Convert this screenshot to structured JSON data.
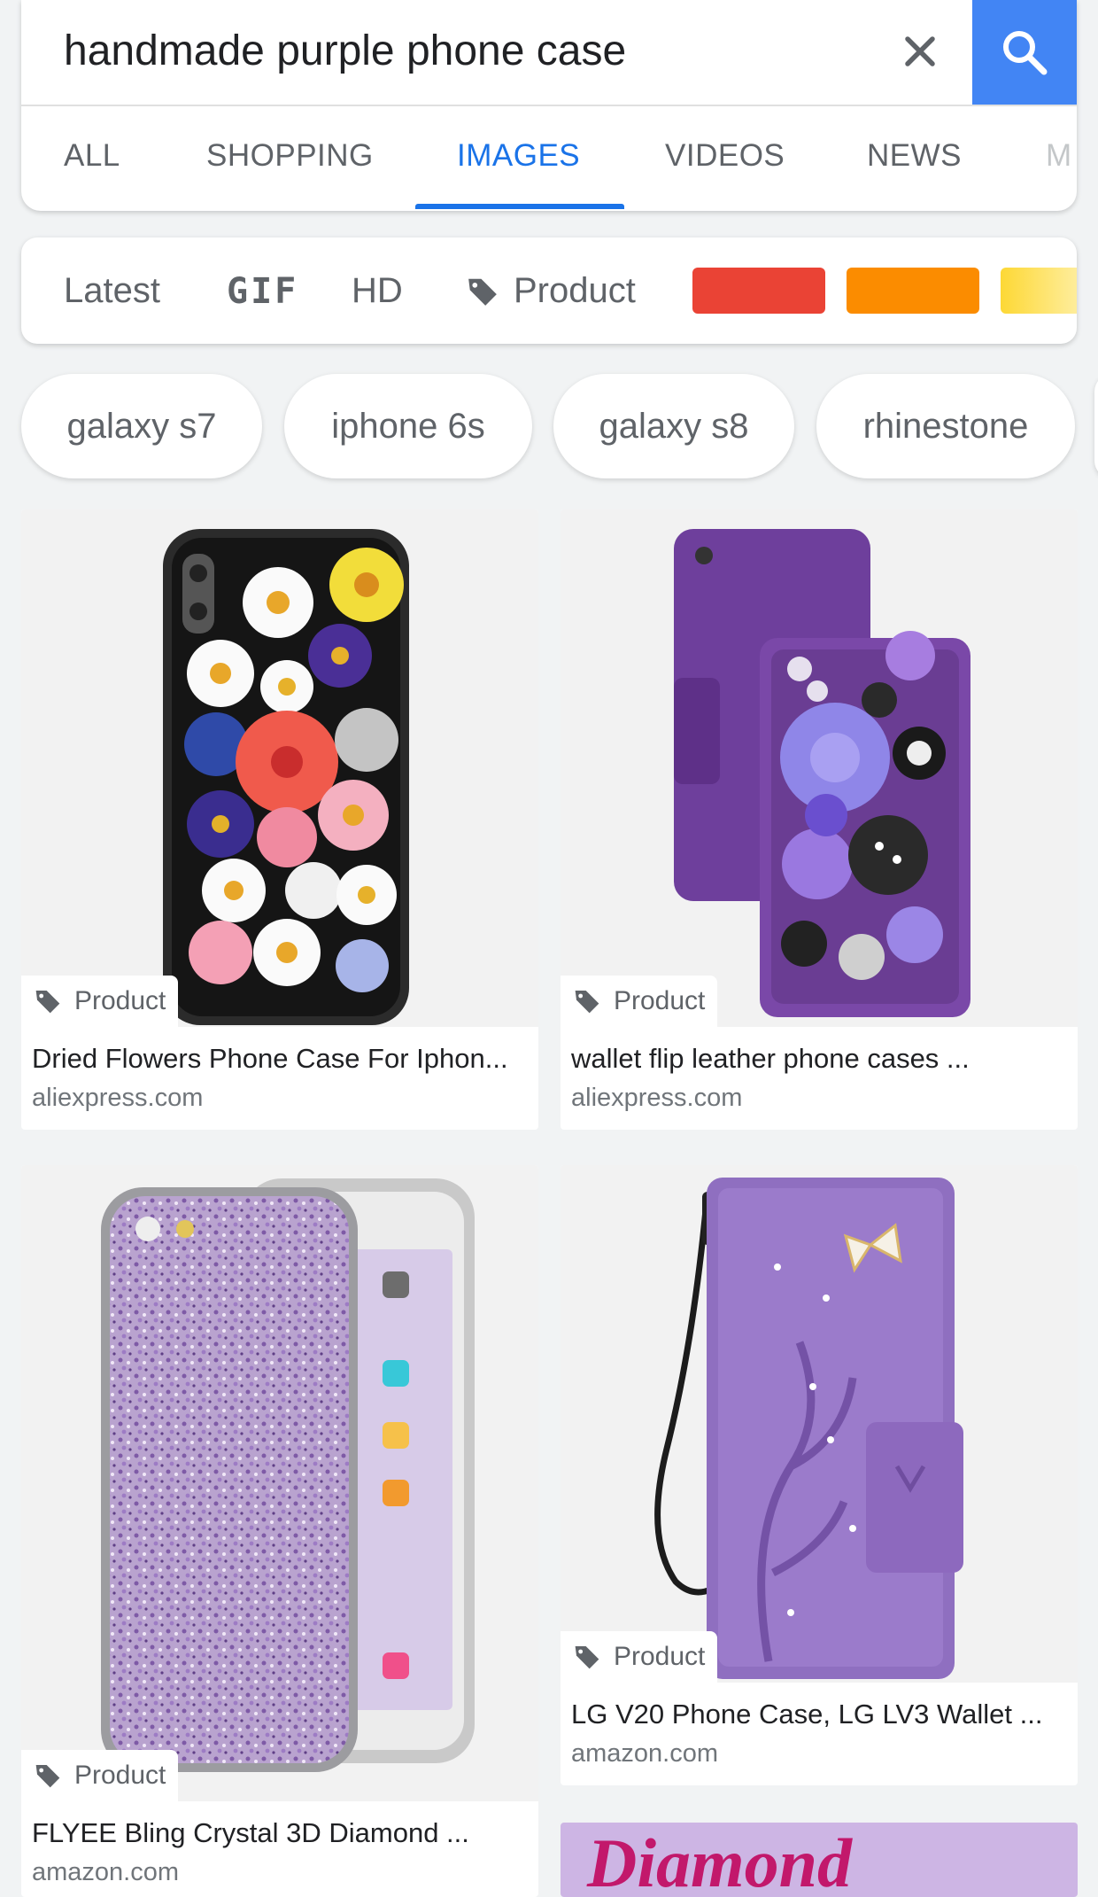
{
  "search": {
    "query": "handmade purple phone case",
    "clear_icon": "close-icon",
    "search_icon": "search-icon",
    "accent": "#4285f4"
  },
  "tabs": [
    {
      "label": "ALL",
      "active": false
    },
    {
      "label": "SHOPPING",
      "active": false
    },
    {
      "label": "IMAGES",
      "active": true
    },
    {
      "label": "VIDEOS",
      "active": false
    },
    {
      "label": "NEWS",
      "active": false
    },
    {
      "label": "M",
      "active": false
    }
  ],
  "filters": {
    "latest": "Latest",
    "gif": "GIF",
    "hd": "HD",
    "product": "Product",
    "product_icon": "tag-icon",
    "colors": [
      "#ea4335",
      "#fb8c00",
      "#fdd835"
    ]
  },
  "chips": [
    "galaxy s7",
    "iphone 6s",
    "galaxy s8",
    "rhinestone"
  ],
  "results": [
    {
      "badge": "Product",
      "title": "Dried Flowers Phone Case For Iphon...",
      "source": "aliexpress.com"
    },
    {
      "badge": "Product",
      "title": "wallet flip leather phone cases ...",
      "source": "aliexpress.com"
    },
    {
      "badge": "Product",
      "title": "FLYEE Bling Crystal 3D Diamond ...",
      "source": "amazon.com"
    },
    {
      "badge": "Product",
      "title": "LG V20 Phone Case, LG LV3 Wallet ...",
      "source": "amazon.com"
    }
  ],
  "partial_result": {
    "image_text": "Diamond"
  }
}
